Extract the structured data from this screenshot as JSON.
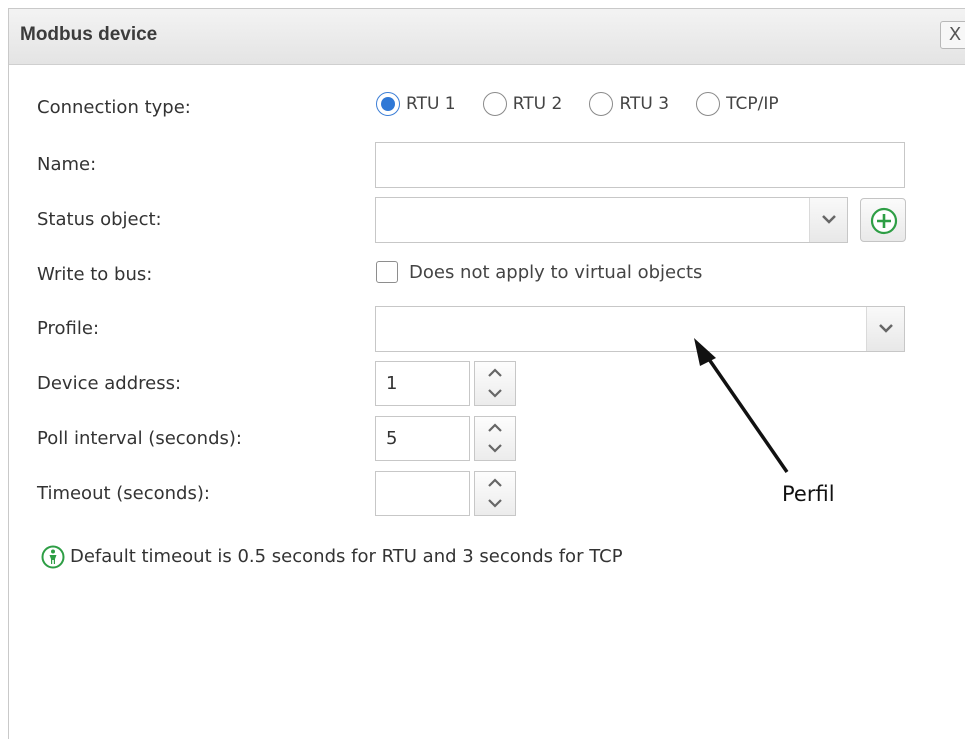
{
  "dialog": {
    "title": "Modbus device",
    "close_label": "X"
  },
  "form": {
    "connection_type": {
      "label": "Connection type:",
      "options": [
        "RTU 1",
        "RTU 2",
        "RTU 3",
        "TCP/IP"
      ],
      "selected": "RTU 1"
    },
    "name": {
      "label": "Name:",
      "value": ""
    },
    "status_object": {
      "label": "Status object:",
      "value": ""
    },
    "write_to_bus": {
      "label": "Write to bus:",
      "checkbox_label": "Does not apply to virtual objects",
      "checked": false
    },
    "profile": {
      "label": "Profile:",
      "value": ""
    },
    "device_address": {
      "label": "Device address:",
      "value": "1"
    },
    "poll_interval": {
      "label": "Poll interval (seconds):",
      "value": "5"
    },
    "timeout": {
      "label": "Timeout (seconds):",
      "value": ""
    }
  },
  "info": {
    "icon": "info-person-icon",
    "text": "Default timeout is 0.5 seconds for RTU and 3 seconds for TCP"
  },
  "annotation": {
    "label": "Perfil"
  },
  "colors": {
    "accent": "#2f78d6",
    "add_icon": "#2e9e45",
    "info_icon": "#2e9e45"
  }
}
